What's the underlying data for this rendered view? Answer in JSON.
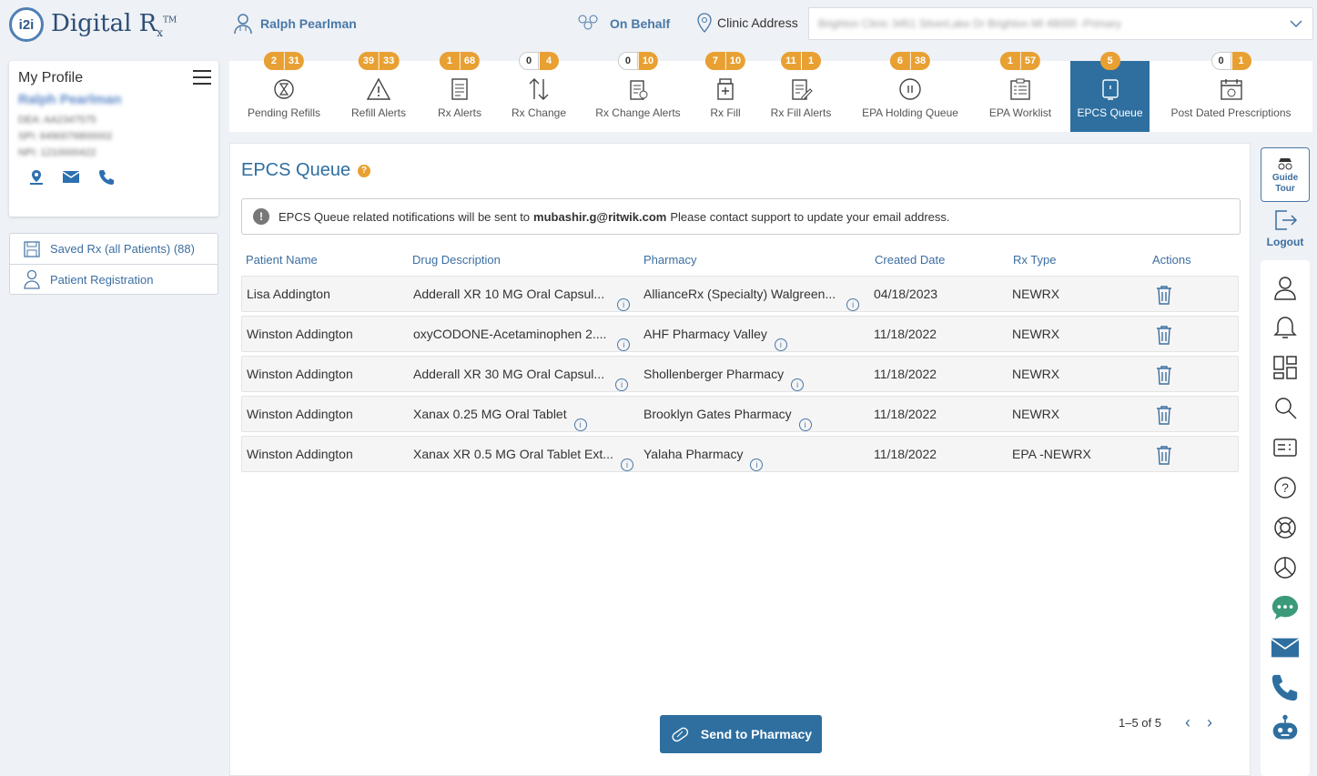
{
  "brand": {
    "logo_mark": "i2i",
    "name": "Digital R",
    "sub": "x",
    "tm": "TM"
  },
  "header": {
    "user_name": "Ralph Pearlman",
    "on_behalf": "On Behalf",
    "clinic_label": "Clinic Address",
    "clinic_value": "Brighton Clinic 3451 SilverLake Dr Brighton MI 48000 -Primary"
  },
  "profile": {
    "title": "My Profile",
    "name": "Ralph Pearlman",
    "dea": "DEA: AA2347575",
    "spi": "SPI: 6490076800002",
    "npi": "NPI: 1210000422"
  },
  "side_menu": {
    "saved_rx": "Saved Rx (all Patients) (88)",
    "patient_registration": "Patient Registration"
  },
  "tabs": [
    {
      "label": "Pending Refills",
      "b1": "2",
      "b2": "31"
    },
    {
      "label": "Refill Alerts",
      "b1": "39",
      "b2": "33"
    },
    {
      "label": "Rx Alerts",
      "b1": "1",
      "b2": "68"
    },
    {
      "label": "Rx Change",
      "b1": "0",
      "b2": "4"
    },
    {
      "label": "Rx Change Alerts",
      "b1": "0",
      "b2": "10"
    },
    {
      "label": "Rx Fill",
      "b1": "7",
      "b2": "10"
    },
    {
      "label": "Rx Fill Alerts",
      "b1": "11",
      "b2": "1"
    },
    {
      "label": "EPA Holding Queue",
      "b1": "6",
      "b2": "38"
    },
    {
      "label": "EPA Worklist",
      "b1": "1",
      "b2": "57"
    },
    {
      "label": "EPCS Queue",
      "b1": "5"
    },
    {
      "label": "Post Dated Prescriptions",
      "b1": "0",
      "b2": "1"
    }
  ],
  "main": {
    "title": "EPCS Queue",
    "help": "?",
    "notice_pre": "EPCS Queue related notifications will be sent to",
    "notice_email": "mubashir.g@ritwik.com",
    "notice_post": "Please contact support to update your email address.",
    "columns": [
      "Patient Name",
      "Drug Description",
      "Pharmacy",
      "Created Date",
      "Rx Type",
      "Actions"
    ],
    "rows": [
      {
        "patient": "Lisa Addington",
        "drug": "Adderall XR 10 MG Oral Capsul...",
        "pharmacy": "AllianceRx (Specialty) Walgreen...",
        "date": "04/18/2023",
        "type": "NEWRX"
      },
      {
        "patient": "Winston Addington",
        "drug": "oxyCODONE-Acetaminophen 2....",
        "pharmacy": "AHF Pharmacy Valley",
        "date": "11/18/2022",
        "type": "NEWRX"
      },
      {
        "patient": "Winston Addington",
        "drug": "Adderall XR 30 MG Oral Capsul...",
        "pharmacy": "Shollenberger Pharmacy",
        "date": "11/18/2022",
        "type": "NEWRX"
      },
      {
        "patient": "Winston Addington",
        "drug": "Xanax 0.25 MG Oral Tablet",
        "pharmacy": "Brooklyn Gates Pharmacy",
        "date": "11/18/2022",
        "type": "NEWRX"
      },
      {
        "patient": "Winston Addington",
        "drug": "Xanax XR 0.5 MG Oral Tablet Ext...",
        "pharmacy": "Yalaha Pharmacy",
        "date": "11/18/2022",
        "type": "EPA -NEWRX"
      }
    ],
    "send_button": "Send to Pharmacy",
    "pager_text": "1–5 of 5"
  },
  "right_rail": {
    "guide_tour": "Guide Tour",
    "logout": "Logout"
  },
  "colors": {
    "accent": "#2e6fa0",
    "badge": "#e8a033",
    "link": "#3c6ea0"
  }
}
